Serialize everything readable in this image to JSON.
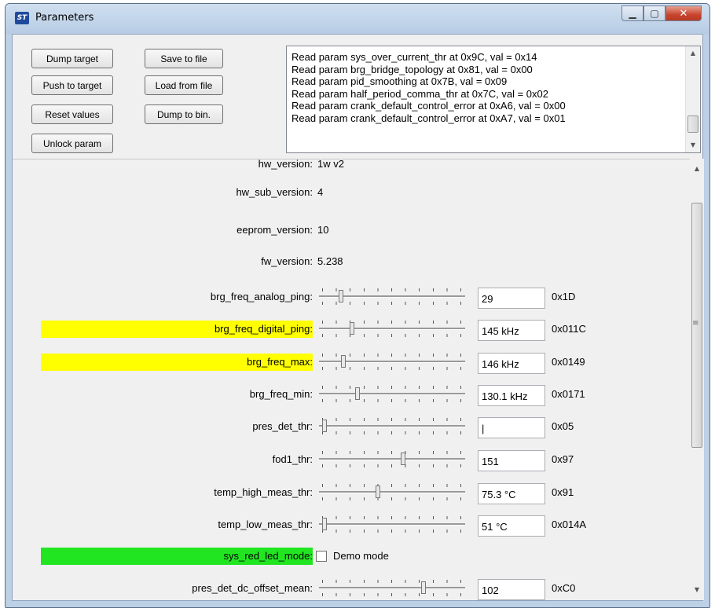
{
  "window": {
    "title": "Parameters",
    "icon_text": "ST",
    "controls": {
      "minimize": "▁",
      "maximize": "▢",
      "close": "✕"
    }
  },
  "buttons": {
    "dump_target": "Dump target",
    "push_to_target": "Push to target",
    "reset_values": "Reset values",
    "unlock_param": "Unlock param",
    "save_to_file": "Save to file",
    "load_from_file": "Load from file",
    "dump_to_bin": "Dump to bin."
  },
  "log": {
    "lines": [
      "Read param sys_over_current_thr at 0x9C, val = 0x14",
      "Read param brg_bridge_topology at 0x81, val = 0x00",
      "Read param pid_smoothing at 0x7B, val = 0x09",
      "Read param half_period_comma_thr at 0x7C, val = 0x02",
      "Read param crank_default_control_error at 0xA6, val = 0x00",
      "Read param crank_default_control_error at 0xA7, val = 0x01"
    ]
  },
  "params": {
    "info": [
      {
        "label": "hw_version:",
        "value": "1w v2"
      },
      {
        "label": "hw_sub_version:",
        "value": "4"
      },
      {
        "label": "eeprom_version:",
        "value": "10"
      },
      {
        "label": "fw_version:",
        "value": "5.238"
      }
    ],
    "sliders": [
      {
        "label": "brg_freq_analog_ping:",
        "value": "29",
        "hex": "0x1D",
        "highlight": "",
        "level": 0.14
      },
      {
        "label": "brg_freq_digital_ping:",
        "value": "145 kHz",
        "hex": "0x011C",
        "highlight": "#ffff00",
        "level": 0.22
      },
      {
        "label": "brg_freq_max:",
        "value": "146 kHz",
        "hex": "0x0149",
        "highlight": "#ffff00",
        "level": 0.16
      },
      {
        "label": "brg_freq_min:",
        "value": "130.1 kHz",
        "hex": "0x0171",
        "highlight": "",
        "level": 0.26
      },
      {
        "label": "pres_det_thr:",
        "value": "|",
        "hex": "0x05",
        "highlight": "",
        "level": 0.02
      },
      {
        "label": "fod1_thr:",
        "value": "151",
        "hex": "0x97",
        "highlight": "",
        "level": 0.59
      },
      {
        "label": "temp_high_meas_thr:",
        "value": "75.3 °C",
        "hex": "0x91",
        "highlight": "",
        "level": 0.41
      },
      {
        "label": "temp_low_meas_thr:",
        "value": "51 °C",
        "hex": "0x014A",
        "highlight": "",
        "level": 0.02
      }
    ],
    "checkbox_row": {
      "label": "sys_red_led_mode:",
      "checkbox_label": "Demo mode",
      "checked": false,
      "highlight": "#22e522"
    },
    "partial_row": {
      "label": "pres_det_dc_offset_mean:",
      "value": "102",
      "hex": "0xC0",
      "level": 0.74
    }
  }
}
